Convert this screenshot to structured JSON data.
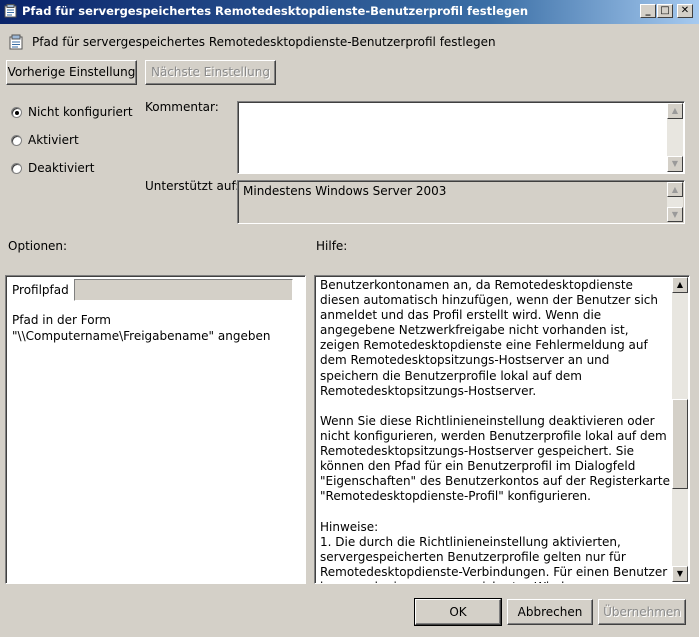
{
  "window": {
    "title": "Pfad für servergespeichertes Remotedesktopdienste-Benutzerprofil festlegen",
    "controls": {
      "minimize": "_",
      "maximize": "□",
      "close": "✕"
    }
  },
  "header": {
    "icon": "policy-setting-icon",
    "text": "Pfad für servergespeichertes Remotedesktopdienste-Benutzerprofil festlegen"
  },
  "nav": {
    "previous": "Vorherige Einstellung",
    "next": "Nächste Einstellung"
  },
  "state": {
    "options": [
      {
        "label": "Nicht konfiguriert",
        "selected": true
      },
      {
        "label": "Aktiviert",
        "selected": false
      },
      {
        "label": "Deaktiviert",
        "selected": false
      }
    ]
  },
  "comment": {
    "label": "Kommentar:",
    "value": ""
  },
  "supported": {
    "label": "Unterstützt auf:",
    "value": "Mindestens Windows Server 2003"
  },
  "options_section": {
    "label": "Optionen:",
    "profile_path_label": "Profilpfad",
    "profile_path_value": "",
    "hint": "Pfad in der Form \"\\\\Computername\\Freigabename\" angeben"
  },
  "help": {
    "label": "Hilfe:",
    "text": "Benutzerkontonamen an, da Remotedesktopdienste diesen automatisch hinzufügen, wenn der Benutzer sich anmeldet und das Profil erstellt wird. Wenn die angegebene Netzwerkfreigabe nicht vorhanden ist, zeigen Remotedesktopdienste eine Fehlermeldung auf dem Remotedesktopsitzungs-Hostserver an und speichern die Benutzerprofile lokal auf dem Remotedesktopsitzungs-Hostserver.\n\nWenn Sie diese Richtlinieneinstellung deaktivieren oder nicht konfigurieren, werden Benutzerprofile lokal auf dem Remotedesktopsitzungs-Hostserver gespeichert. Sie können den Pfad für ein Benutzerprofil im Dialogfeld \"Eigenschaften\" des Benutzerkontos auf der Registerkarte \"Remotedesktopdienste-Profil\" konfigurieren.\n\nHinweise:\n1. Die durch die Richtlinieneinstellung aktivierten, servergespeicherten Benutzerprofile gelten nur für Remotedesktopdienste-Verbindungen. Für einen Benutzer kann auch ein servergespeichertes Windows-Benutzerprofil konfiguriert"
  },
  "footer": {
    "ok": "OK",
    "cancel": "Abbrechen",
    "apply": "Übernehmen"
  }
}
